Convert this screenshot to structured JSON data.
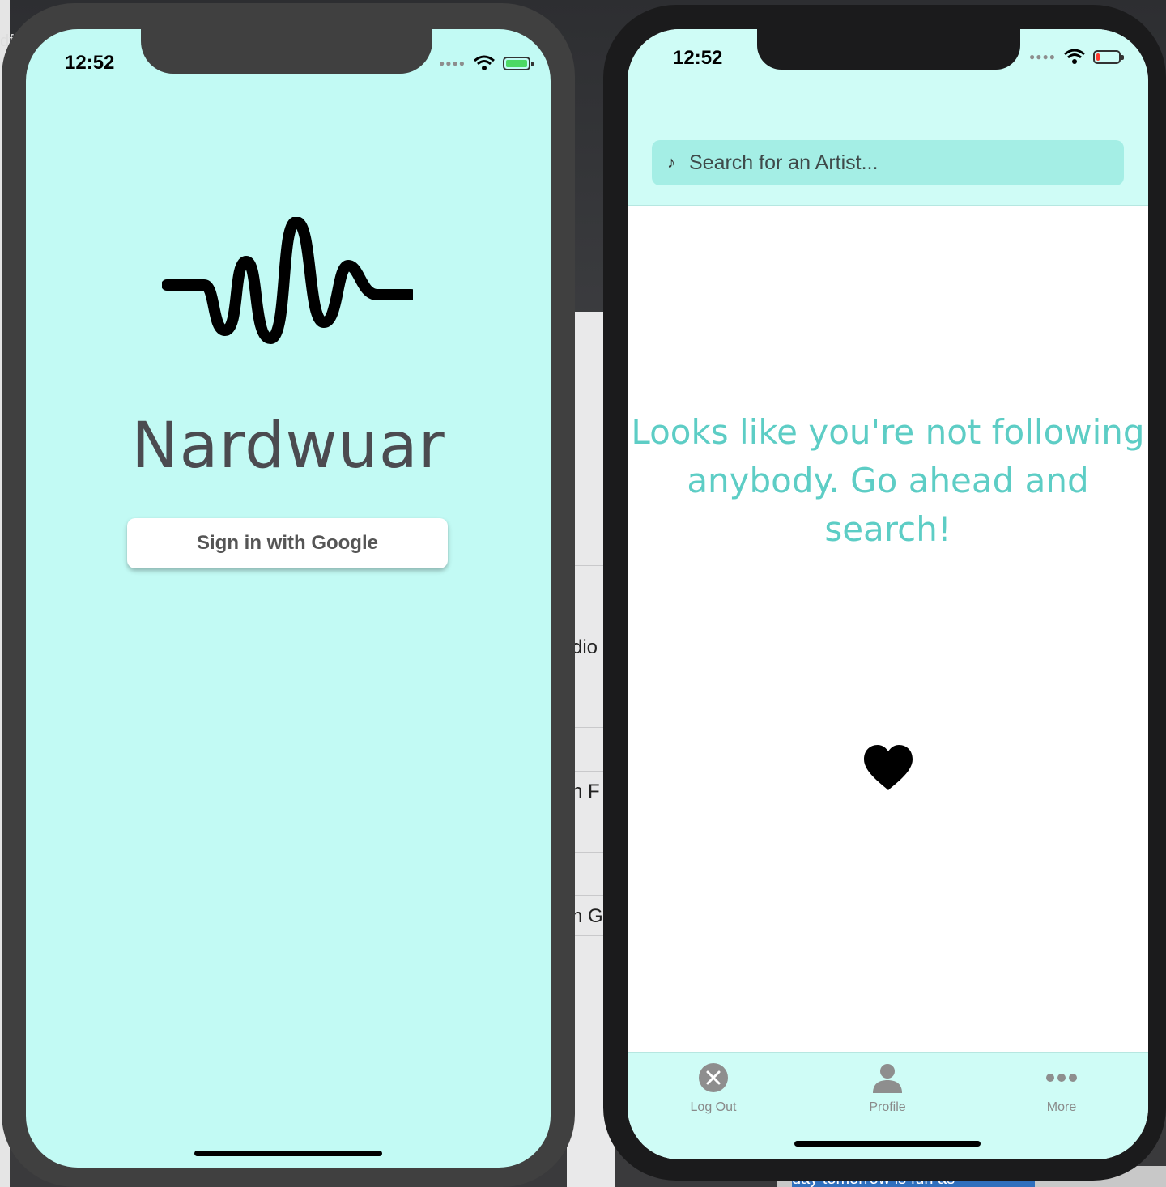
{
  "background": {
    "fragments": [
      "df",
      "dio",
      "n F",
      "n G"
    ],
    "bottom_text": "day tomorrow is fun as"
  },
  "login_screen": {
    "status": {
      "time": "12:52"
    },
    "logo_icon": "soundwave-icon",
    "title": "Nardwuar",
    "signin_label": "Sign in with Google",
    "colors": {
      "background": "#c2faf4",
      "title": "#4b4b50"
    }
  },
  "home_screen": {
    "status": {
      "time": "12:52"
    },
    "search": {
      "placeholder": "Search for an Artist...",
      "value": "",
      "icon": "music-note-icon"
    },
    "empty_message": "Looks like you're not following anybody. Go ahead and search!",
    "heart_icon": "heart-icon",
    "tabs": [
      {
        "label": "Log Out",
        "icon": "close-circle-icon"
      },
      {
        "label": "Profile",
        "icon": "person-icon"
      },
      {
        "label": "More",
        "icon": "more-dots-icon"
      }
    ],
    "colors": {
      "accent": "#5dcdc5",
      "nav_bg": "#cffcf6",
      "search_bg": "#a4eee5"
    }
  }
}
